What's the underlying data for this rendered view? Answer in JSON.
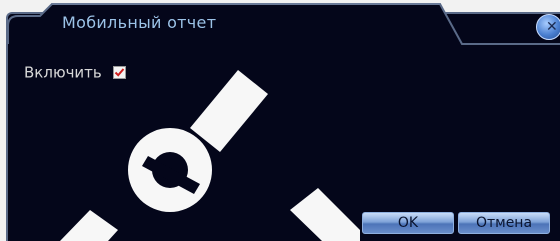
{
  "window": {
    "title": "Мобильный отчет"
  },
  "form": {
    "enable_label": "Включить",
    "enable_checked": true
  },
  "buttons": {
    "ok_label": "OK",
    "cancel_label": "Отмена"
  },
  "icons": {
    "close": "close-icon",
    "checkbox": "checkmark-icon"
  },
  "colors": {
    "window_bg": "#04061a",
    "title_text": "#9cc3e8",
    "label_text": "#d8d8d8",
    "button_blue": "#4d74b8",
    "check_red": "#d02020",
    "watermark": "#ffffff"
  }
}
